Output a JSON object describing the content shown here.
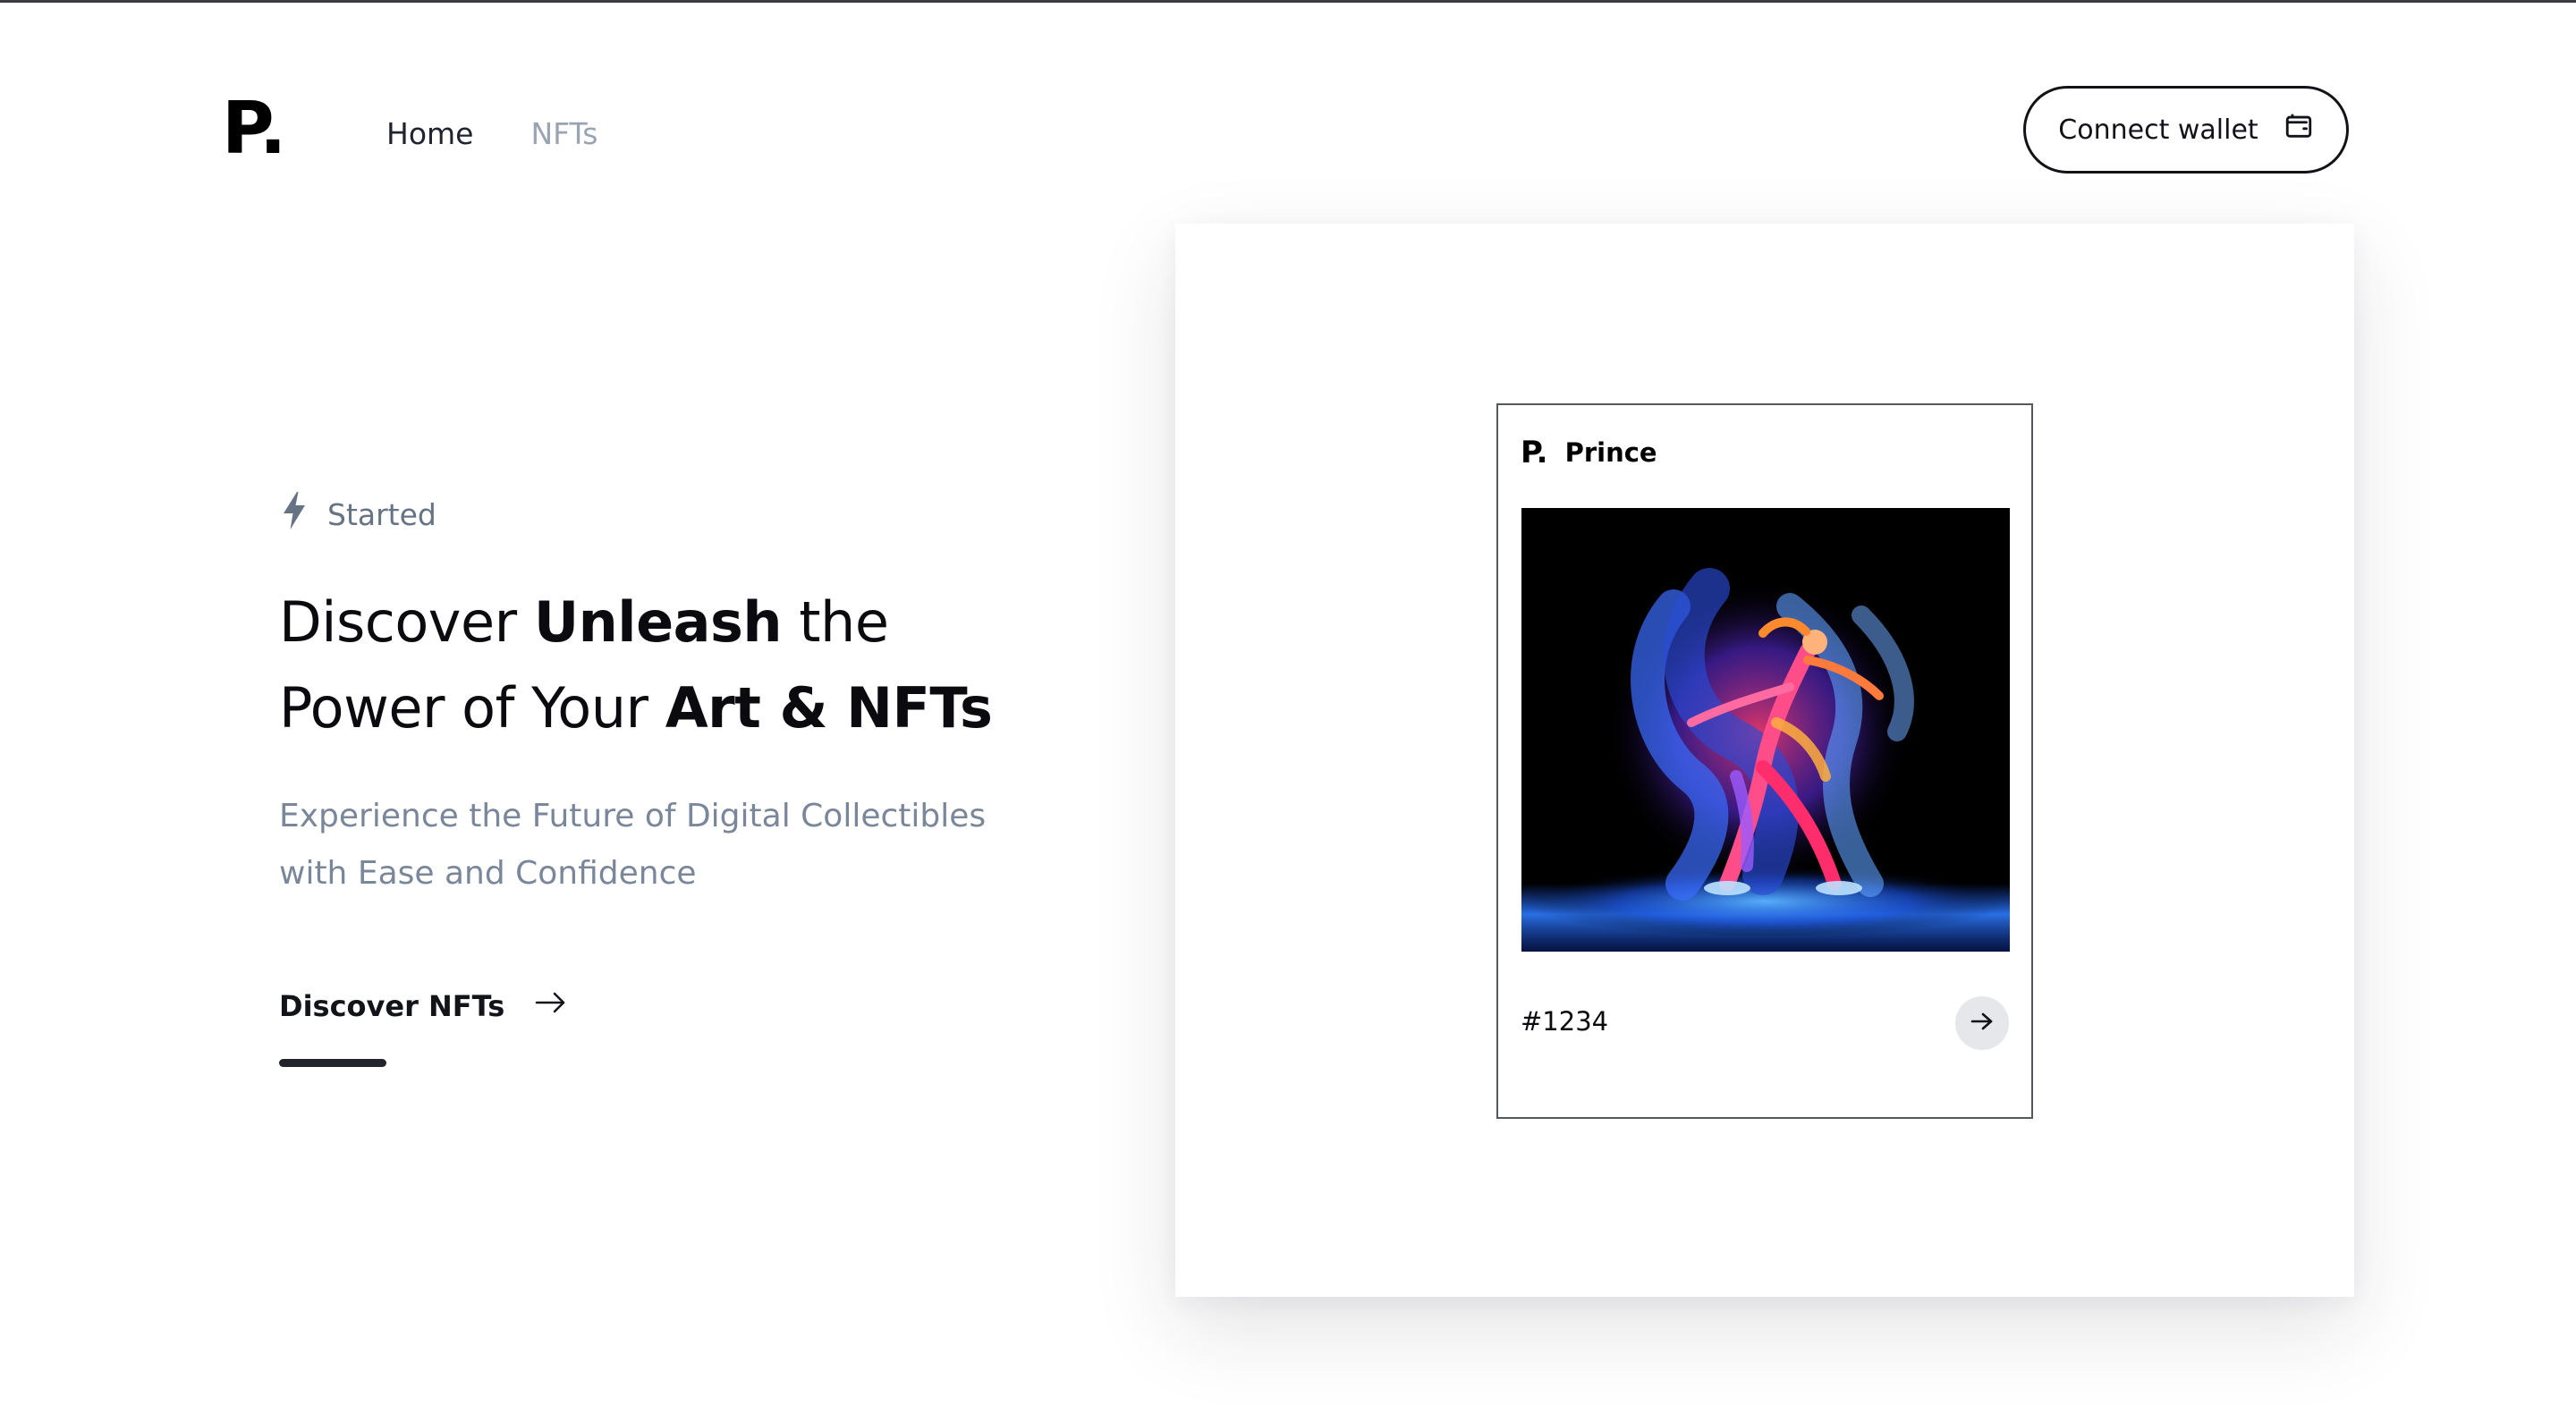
{
  "header": {
    "logo": "P.",
    "nav": [
      {
        "label": "Home"
      },
      {
        "label": "NFTs"
      }
    ],
    "connect_label": "Connect wallet"
  },
  "hero": {
    "eyebrow": "Started",
    "headline": {
      "line1_pre": "Discover ",
      "line1_bold": "Unleash",
      "line1_post": " the",
      "line2_pre": "Power of Your ",
      "line2_bold": "Art & NFTs"
    },
    "subtext_line1": "Experience the Future of Digital Collectibles",
    "subtext_line2": "with Ease and Confidence",
    "cta_label": "Discover NFTs"
  },
  "nft_card": {
    "logo": "P.",
    "name": "Prince",
    "id": "#1234",
    "image_icon": "neon-dancer-artwork"
  },
  "colors": {
    "text_primary": "#0b0b0f",
    "text_muted": "#7a879a",
    "nav_muted": "#9aa3b1"
  }
}
